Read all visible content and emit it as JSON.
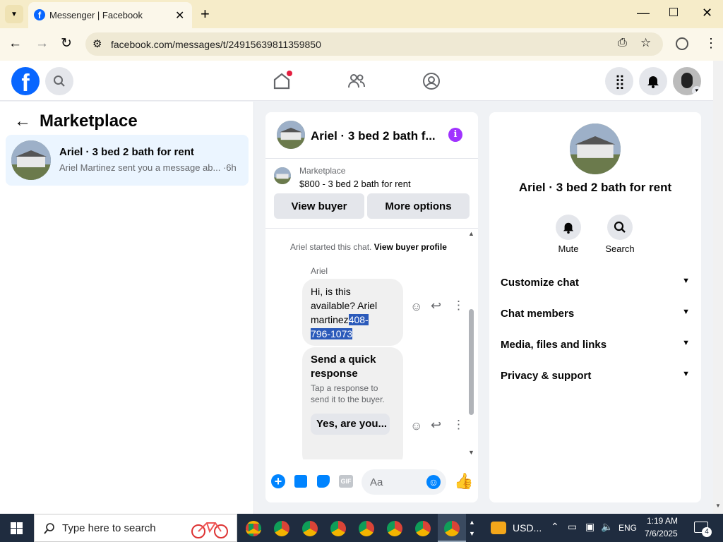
{
  "browser": {
    "tab_title": "Messenger | Facebook",
    "url": "facebook.com/messages/t/24915639811359850"
  },
  "left": {
    "title": "Marketplace",
    "conversation": {
      "name": "Ariel · 3 bed 2 bath for rent",
      "preview": "Ariel Martinez sent you a message ab...",
      "time": "·6h"
    }
  },
  "chat": {
    "header_name": "Ariel · 3 bed 2 bath f...",
    "marketplace_label": "Marketplace",
    "listing": "$800 - 3 bed 2 bath for rent",
    "view_buyer": "View buyer",
    "more_options": "More options",
    "system_text": "Ariel started this chat.",
    "system_link": "View buyer profile",
    "sender": "Ariel",
    "message_plain": "Hi, is this available? Ariel martinez",
    "message_selected_1": "408-",
    "message_selected_2": "796-1073",
    "quick_title": "Send a quick response",
    "quick_sub": "Tap a response to send it to the buyer.",
    "quick_reply": "Yes, are you...",
    "composer_placeholder": "Aa"
  },
  "right": {
    "name": "Ariel · 3 bed 2 bath for rent",
    "mute": "Mute",
    "search": "Search",
    "sections": [
      "Customize chat",
      "Chat members",
      "Media, files and links",
      "Privacy & support"
    ]
  },
  "taskbar": {
    "search_placeholder": "Type here to search",
    "currency": "USD...",
    "lang": "ENG",
    "time": "1:19 AM",
    "date": "7/6/2025",
    "notif_count": "4"
  },
  "colors": {
    "fb_blue": "#0866ff",
    "messenger_blue": "#0084ff",
    "purple": "#a033ff"
  }
}
